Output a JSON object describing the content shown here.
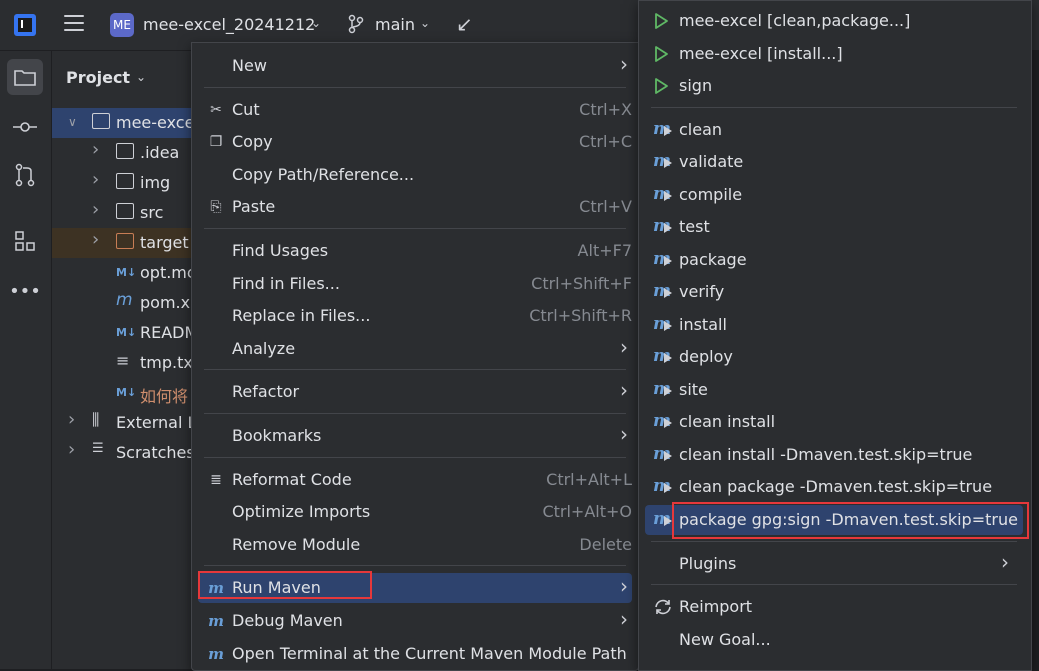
{
  "titlebar": {
    "project_badge": "ME",
    "project_name": "mee-excel_20241212",
    "branch": "main"
  },
  "project_panel": {
    "title": "Project",
    "tree": [
      {
        "label": "mee-excel",
        "level": 0,
        "expanded": true,
        "icon": "module-folder-icon",
        "selected": true
      },
      {
        "label": ".idea",
        "level": 1,
        "icon": "folder-icon"
      },
      {
        "label": "img",
        "level": 1,
        "icon": "folder-icon"
      },
      {
        "label": "src",
        "level": 1,
        "icon": "folder-icon"
      },
      {
        "label": "target",
        "level": 1,
        "icon": "excluded-folder-icon"
      },
      {
        "label": "opt.mc",
        "level": 1,
        "icon": "markdown-icon"
      },
      {
        "label": "pom.xı",
        "level": 1,
        "icon": "maven-icon"
      },
      {
        "label": "READM",
        "level": 1,
        "icon": "markdown-icon"
      },
      {
        "label": "tmp.tx",
        "level": 1,
        "icon": "text-file-icon"
      },
      {
        "label": "如何将",
        "level": 1,
        "icon": "markdown-icon"
      },
      {
        "label": "External L",
        "level": 0,
        "icon": "library-icon"
      },
      {
        "label": "Scratches",
        "level": 0,
        "icon": "scratches-icon"
      }
    ]
  },
  "context_menu": {
    "items": [
      {
        "label": "New",
        "submenu": true
      },
      {
        "label": "Cut",
        "shortcut": "Ctrl+X",
        "icon": "scissors-icon"
      },
      {
        "label": "Copy",
        "shortcut": "Ctrl+C",
        "icon": "copy-icon"
      },
      {
        "label": "Copy Path/Reference..."
      },
      {
        "label": "Paste",
        "shortcut": "Ctrl+V",
        "icon": "paste-icon"
      },
      {
        "label": "Find Usages",
        "shortcut": "Alt+F7"
      },
      {
        "label": "Find in Files...",
        "shortcut": "Ctrl+Shift+F"
      },
      {
        "label": "Replace in Files...",
        "shortcut": "Ctrl+Shift+R"
      },
      {
        "label": "Analyze",
        "submenu": true
      },
      {
        "label": "Refactor",
        "submenu": true
      },
      {
        "label": "Bookmarks",
        "submenu": true
      },
      {
        "label": "Reformat Code",
        "shortcut": "Ctrl+Alt+L",
        "icon": "reformat-icon"
      },
      {
        "label": "Optimize Imports",
        "shortcut": "Ctrl+Alt+O"
      },
      {
        "label": "Remove Module",
        "shortcut": "Delete"
      },
      {
        "label": "Run Maven",
        "submenu": true,
        "icon": "maven-run-icon",
        "highlighted": true
      },
      {
        "label": "Debug Maven",
        "submenu": true,
        "icon": "maven-debug-icon"
      },
      {
        "label": "Open Terminal at the Current Maven Module Path",
        "icon": "maven-terminal-icon"
      }
    ]
  },
  "run_maven_submenu": {
    "items": [
      {
        "label": "mee-excel [clean,package...]",
        "icon": "run-config-icon"
      },
      {
        "label": "mee-excel [install...]",
        "icon": "run-config-icon"
      },
      {
        "label": "sign",
        "icon": "run-config-icon"
      },
      {
        "label": "clean",
        "icon": "maven-goal-icon"
      },
      {
        "label": "validate",
        "icon": "maven-goal-icon"
      },
      {
        "label": "compile",
        "icon": "maven-goal-icon"
      },
      {
        "label": "test",
        "icon": "maven-goal-icon"
      },
      {
        "label": "package",
        "icon": "maven-goal-icon"
      },
      {
        "label": "verify",
        "icon": "maven-goal-icon"
      },
      {
        "label": "install",
        "icon": "maven-goal-icon"
      },
      {
        "label": "deploy",
        "icon": "maven-goal-icon"
      },
      {
        "label": "site",
        "icon": "maven-goal-icon"
      },
      {
        "label": "clean install",
        "icon": "maven-goal-icon"
      },
      {
        "label": "clean install -Dmaven.test.skip=true",
        "icon": "maven-goal-icon"
      },
      {
        "label": "clean package -Dmaven.test.skip=true",
        "icon": "maven-goal-icon"
      },
      {
        "label": "package gpg:sign -Dmaven.test.skip=true",
        "icon": "maven-goal-icon",
        "highlighted": true
      },
      {
        "label": "Plugins",
        "submenu": true
      },
      {
        "label": "Reimport",
        "icon": "reimport-icon"
      },
      {
        "label": "New Goal..."
      }
    ]
  },
  "colors": {
    "highlight": "#2e436e",
    "annotation_red": "#e5383b",
    "run_green": "#5fb865"
  }
}
